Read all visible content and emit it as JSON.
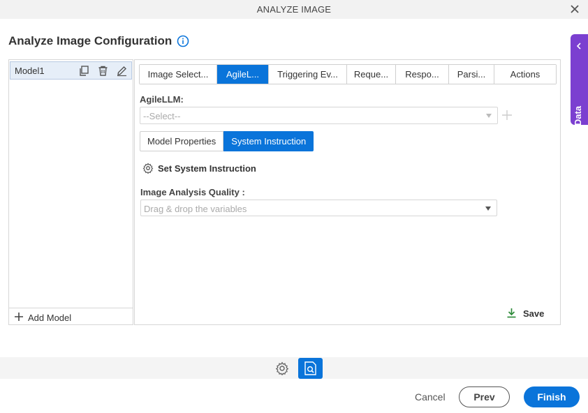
{
  "window": {
    "title": "ANALYZE IMAGE",
    "close_icon": "close-icon"
  },
  "page": {
    "heading": "Analyze Image Configuration",
    "info_icon": "info-icon"
  },
  "app_data": {
    "label": "App Data",
    "icon": "chevron-left-icon",
    "color": "#7b3fd0"
  },
  "models": {
    "items": [
      {
        "name": "Model1"
      }
    ],
    "add_label": "Add Model",
    "row_icons": [
      "copy-icon",
      "trash-icon",
      "edit-icon"
    ]
  },
  "tabs": {
    "items": [
      {
        "label": "Image Select..."
      },
      {
        "label": "AgileL..."
      },
      {
        "label": "Triggering Ev..."
      },
      {
        "label": "Reque..."
      },
      {
        "label": "Respo..."
      },
      {
        "label": "Parsi..."
      },
      {
        "label": "Actions"
      }
    ],
    "active": "AgileL...",
    "accent": "#0a74da"
  },
  "agilellm": {
    "label": "AgileLLM:",
    "placeholder": "--Select--"
  },
  "subtabs": {
    "items": [
      {
        "label": "Model Properties"
      },
      {
        "label": "System Instruction"
      }
    ],
    "active": "System Instruction"
  },
  "system_instruction": {
    "label": "Set System Instruction",
    "icon": "gear-icon"
  },
  "quality": {
    "label": "Image Analysis Quality :",
    "placeholder": "Drag & drop the variables"
  },
  "save": {
    "label": "Save",
    "icon": "download-icon",
    "color": "#2e8b3a"
  },
  "bottom_toolbar": {
    "icons": [
      "gear-icon",
      "image-search-icon"
    ]
  },
  "footer": {
    "cancel": "Cancel",
    "prev": "Prev",
    "finish": "Finish"
  }
}
